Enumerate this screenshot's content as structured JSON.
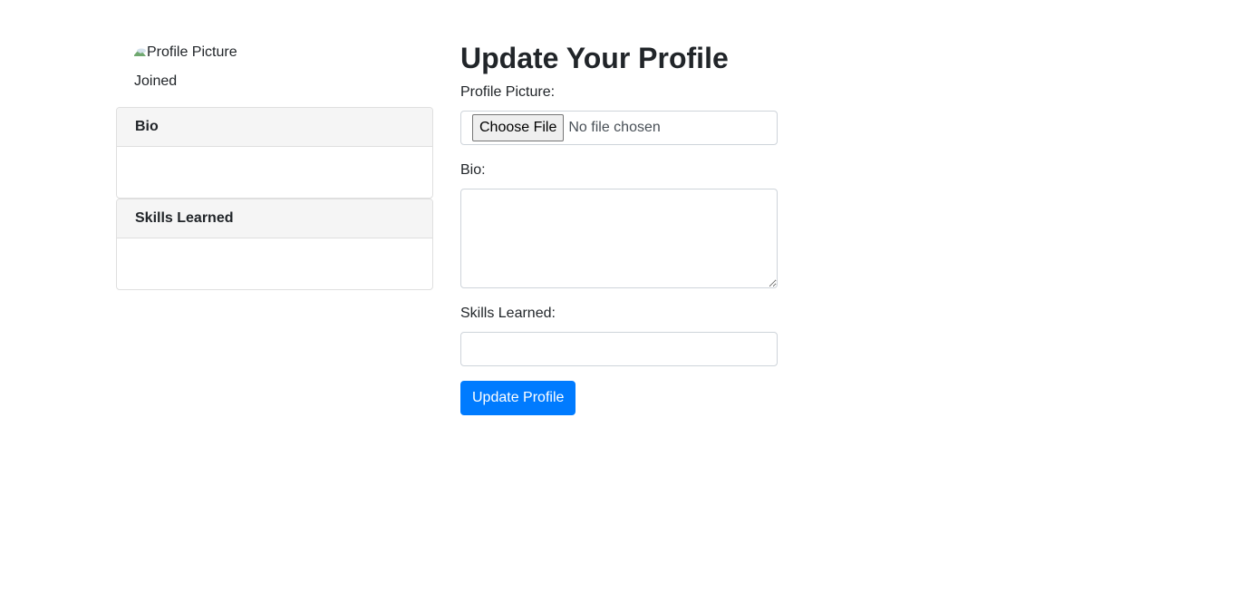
{
  "sidebar": {
    "profile_picture_alt": "Profile Picture",
    "joined_label": "Joined",
    "cards": [
      {
        "title": "Bio",
        "body": ""
      },
      {
        "title": "Skills Learned",
        "body": ""
      }
    ]
  },
  "form": {
    "title": "Update Your Profile",
    "profile_picture_label": "Profile Picture:",
    "file_button_label": "Choose File",
    "file_status": "No file chosen",
    "bio_label": "Bio:",
    "bio_value": "",
    "skills_label": "Skills Learned:",
    "skills_value": "",
    "submit_label": "Update Profile"
  },
  "colors": {
    "primary": "#007bff",
    "card_header_bg": "#f5f5f5",
    "border": "#dfdfdf",
    "text": "#212529"
  }
}
